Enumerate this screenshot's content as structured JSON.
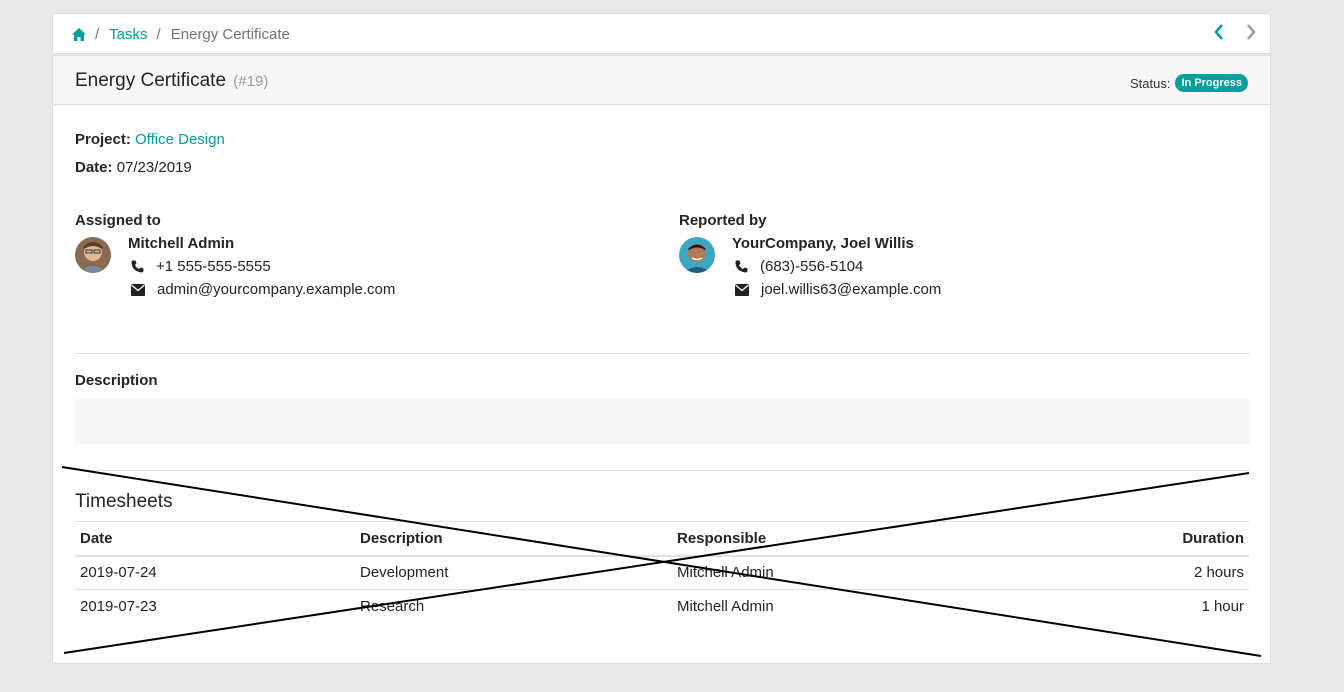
{
  "breadcrumb": {
    "home_icon": "home-icon",
    "separator": "/",
    "items": [
      "Tasks",
      "Energy Certificate"
    ]
  },
  "pager": {
    "prev_icon": "chevron-left-icon",
    "next_icon": "chevron-right-icon"
  },
  "task": {
    "title": "Energy Certificate",
    "ref": "(#19)",
    "status_label": "Status:",
    "status": "In Progress",
    "project_label": "Project:",
    "project": "Office Design",
    "date_label": "Date:",
    "date": "07/23/2019"
  },
  "assigned": {
    "heading": "Assigned to",
    "name": "Mitchell Admin",
    "phone": "+1 555-555-5555",
    "email": "admin@yourcompany.example.com"
  },
  "reported": {
    "heading": "Reported by",
    "name": "YourCompany, Joel Willis",
    "phone": "(683)-556-5104",
    "email": "joel.willis63@example.com"
  },
  "description": {
    "heading": "Description",
    "content": ""
  },
  "timesheets": {
    "heading": "Timesheets",
    "columns": [
      "Date",
      "Description",
      "Responsible",
      "Duration"
    ],
    "rows": [
      [
        "2019-07-24",
        "Development",
        "Mitchell Admin",
        "2 hours"
      ],
      [
        "2019-07-23",
        "Research",
        "Mitchell Admin",
        "1 hour"
      ]
    ]
  },
  "colors": {
    "accent": "#00a09d",
    "muted": "#6c757d"
  }
}
